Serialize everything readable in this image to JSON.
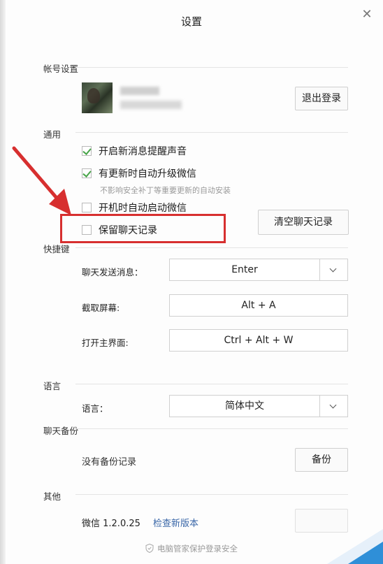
{
  "window": {
    "title": "设置",
    "close_glyph": "✕"
  },
  "account": {
    "section_label": "帐号设置",
    "logout_label": "退出登录"
  },
  "general": {
    "section_label": "通用",
    "options": [
      {
        "label": "开启新消息提醒声音",
        "checked": true
      },
      {
        "label": "有更新时自动升级微信",
        "checked": true
      },
      {
        "label": "开机时自动启动微信",
        "checked": false
      },
      {
        "label": "保留聊天记录",
        "checked": false
      }
    ],
    "update_hint": "不影响安全补丁等重要更新的自动安装",
    "clear_chat_label": "清空聊天记录"
  },
  "shortcuts": {
    "section_label": "快捷键",
    "items": [
      {
        "label": "聊天发送消息：",
        "value": "Enter",
        "dropdown": true
      },
      {
        "label": "截取屏幕:",
        "value": "Alt + A",
        "dropdown": false
      },
      {
        "label": "打开主界面:",
        "value": "Ctrl + Alt + W",
        "dropdown": false
      }
    ]
  },
  "language": {
    "section_label": "语言",
    "label": "语言：",
    "value": "简体中文"
  },
  "backup": {
    "section_label": "聊天备份",
    "status": "没有备份记录",
    "button_label": "备份"
  },
  "other": {
    "section_label": "其他",
    "version": "微信 1.2.0.25",
    "check_update_label": "检查新版本"
  },
  "footer": {
    "text": "电脑管家保护登录安全"
  },
  "colors": {
    "check": "#49a54a",
    "annotation": "#d72f2f",
    "link": "#3a67a8",
    "corner_accent": "#2f8fd8"
  }
}
